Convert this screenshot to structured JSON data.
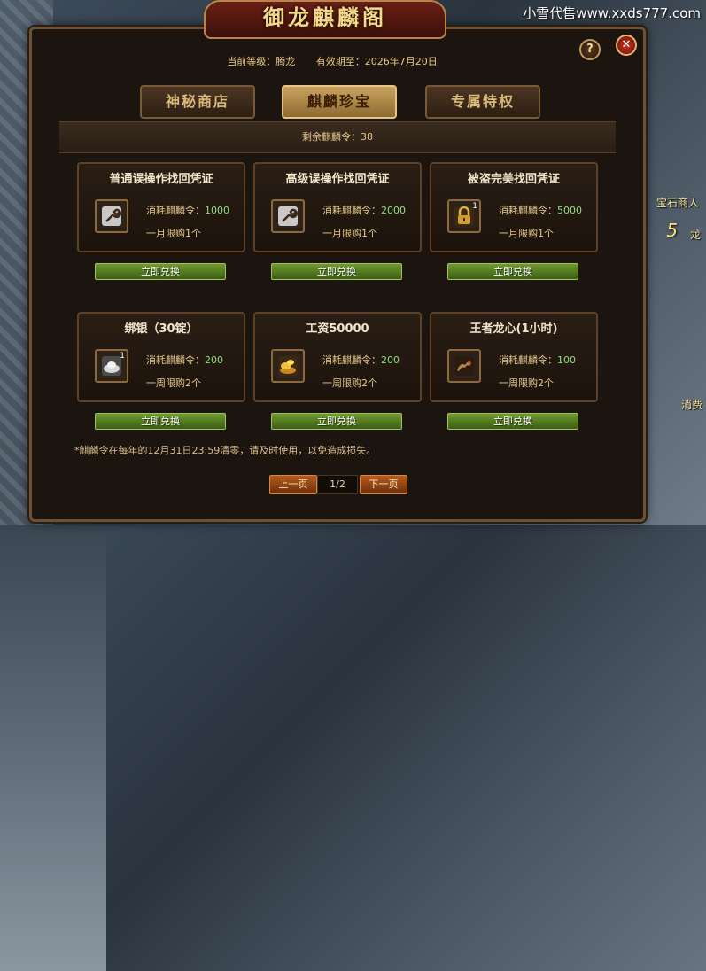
{
  "watermark": "小雪代售www.xxds777.com",
  "background": {
    "npc_label_1": "宝石商人",
    "npc_label_2": "龙",
    "npc_number": "5",
    "npc_label_3": "消费"
  },
  "window": {
    "title": "御龙麒麟阁",
    "info": {
      "level": "当前等级：腾龙",
      "expiry": "有效期至：2026年7月20日"
    },
    "help_glyph": "?",
    "close_glyph": "✕",
    "tabs": [
      {
        "label": "神秘商店",
        "active": false
      },
      {
        "label": "麒麟珍宝",
        "active": true
      },
      {
        "label": "专属特权",
        "active": false
      }
    ],
    "remaining": "剩余麒麟令：38",
    "cost_prefix": "消耗麒麟令：",
    "redeem_label": "立即兑换",
    "items": [
      {
        "name": "普通误操作找回凭证",
        "icon": "wrench-icon",
        "qty": "",
        "cost": "1000",
        "limit": "一月限购1个"
      },
      {
        "name": "高级误操作找回凭证",
        "icon": "wrench-icon",
        "qty": "",
        "cost": "2000",
        "limit": "一月限购1个"
      },
      {
        "name": "被盗完美找回凭证",
        "icon": "lock-icon",
        "qty": "1",
        "cost": "5000",
        "limit": "一月限购1个"
      },
      {
        "name": "绑银（30锭）",
        "icon": "silver-ingot-icon",
        "qty": "1",
        "cost": "200",
        "limit": "一周限购2个"
      },
      {
        "name": "工资50000",
        "icon": "gold-coins-icon",
        "qty": "",
        "cost": "200",
        "limit": "一周限购2个"
      },
      {
        "name": "王者龙心(1小时)",
        "icon": "dragon-icon",
        "qty": "",
        "cost": "100",
        "limit": "一周限购2个"
      }
    ],
    "note": "*麒麟令在每年的12月31日23:59清零，请及时使用，以免造成损失。",
    "pager": {
      "prev": "上一页",
      "page": "1/2",
      "next": "下一页"
    }
  },
  "colors": {
    "accent_gold": "#e6c88c",
    "cost_green": "#8fe07a",
    "button_green": "#6e9a2c",
    "pager_orange": "#b65a1e"
  }
}
